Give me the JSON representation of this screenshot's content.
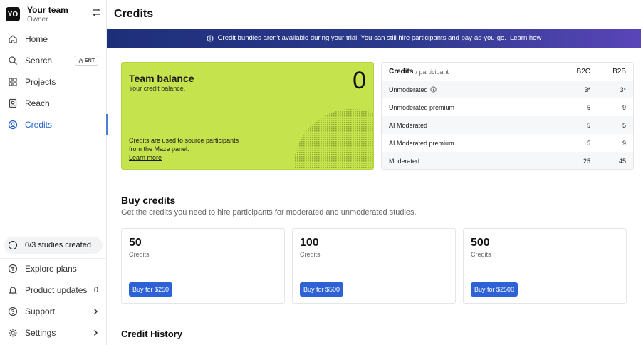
{
  "team": {
    "avatar": "YO",
    "name": "Your team",
    "role": "Owner"
  },
  "nav": {
    "items": [
      {
        "label": "Home",
        "icon": "home-icon"
      },
      {
        "label": "Search",
        "icon": "search-icon",
        "badge": "ENT"
      },
      {
        "label": "Projects",
        "icon": "grid-icon"
      },
      {
        "label": "Reach",
        "icon": "contacts-icon"
      },
      {
        "label": "Credits",
        "icon": "credits-icon",
        "active": true
      }
    ]
  },
  "studies": {
    "label": "0/3 studies created"
  },
  "bottom_nav": {
    "explore": "Explore plans",
    "updates": "Product updates",
    "updates_count": "0",
    "support": "Support",
    "settings": "Settings"
  },
  "page": {
    "title": "Credits"
  },
  "banner": {
    "text": "Credit bundles aren't available during your trial. You can still hire participants and pay-as-you-go.",
    "link": "Learn how"
  },
  "balance": {
    "title": "Team balance",
    "subtitle": "Your credit balance.",
    "value": "0",
    "description": "Credits are used to source participants from the Maze panel.",
    "link": "Learn more",
    "color": "#c5e34d"
  },
  "rates": {
    "title": "Credits",
    "unit": "/ participant",
    "col_b2c": "B2C",
    "col_b2b": "B2B",
    "rows": [
      {
        "label": "Unmoderated",
        "b2c": "3*",
        "b2b": "3*",
        "info": true
      },
      {
        "label": "Unmoderated premium",
        "b2c": "5",
        "b2b": "9"
      },
      {
        "label": "AI Moderated",
        "b2c": "5",
        "b2b": "5"
      },
      {
        "label": "AI Moderated premium",
        "b2c": "5",
        "b2b": "9"
      },
      {
        "label": "Moderated",
        "b2c": "25",
        "b2b": "45"
      }
    ]
  },
  "buy": {
    "title": "Buy credits",
    "subtitle": "Get the credits you need to hire participants for moderated and unmoderated studies.",
    "bundles": [
      {
        "amount": "50",
        "unit": "Credits",
        "button": "Buy for $250"
      },
      {
        "amount": "100",
        "unit": "Credits",
        "button": "Buy for $500"
      },
      {
        "amount": "500",
        "unit": "Credits",
        "button": "Buy for $2500"
      }
    ]
  },
  "history": {
    "title": "Credit History"
  },
  "colors": {
    "accent": "#2d62d6",
    "banner": "#2b3a8c"
  }
}
